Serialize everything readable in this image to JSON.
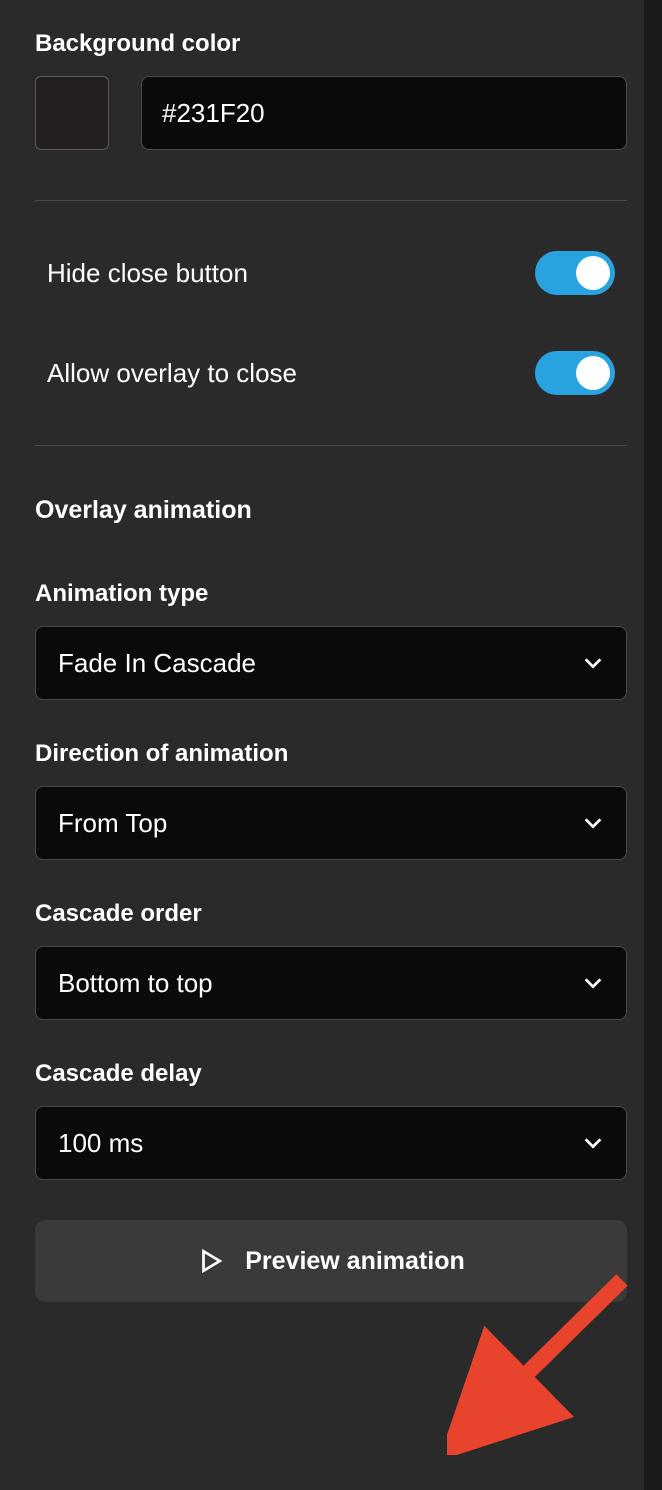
{
  "backgroundColor": {
    "label": "Background color",
    "value": "#231F20",
    "swatchColor": "#231F20"
  },
  "toggles": {
    "hideClose": {
      "label": "Hide close button",
      "state": true
    },
    "allowOverlay": {
      "label": "Allow overlay to close",
      "state": true
    }
  },
  "overlayAnimation": {
    "title": "Overlay animation",
    "animationType": {
      "label": "Animation type",
      "value": "Fade In Cascade"
    },
    "direction": {
      "label": "Direction of animation",
      "value": "From Top"
    },
    "cascadeOrder": {
      "label": "Cascade order",
      "value": "Bottom to top"
    },
    "cascadeDelay": {
      "label": "Cascade delay",
      "value": "100 ms"
    }
  },
  "previewButton": {
    "label": "Preview animation"
  },
  "colors": {
    "toggleActive": "#29a3e0",
    "arrowAnnotation": "#e8432d"
  }
}
